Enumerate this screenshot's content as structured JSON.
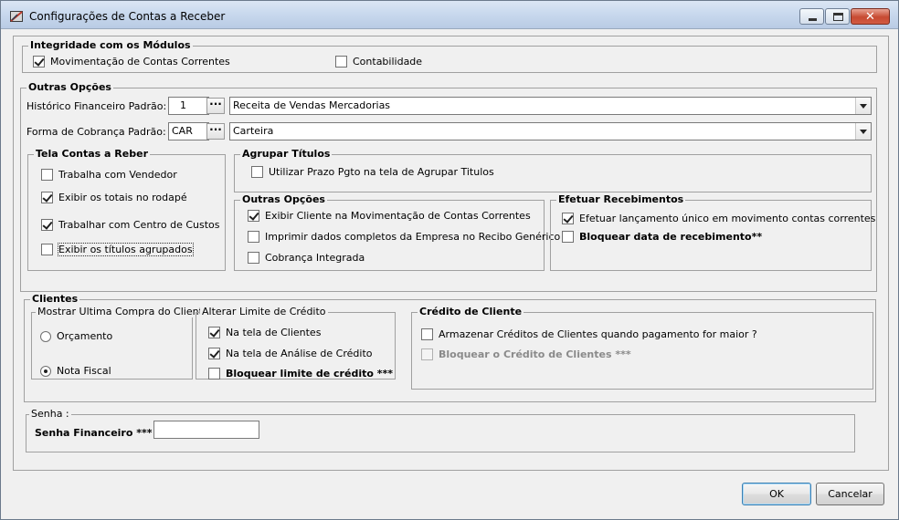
{
  "window": {
    "title": "Configurações de Contas a Receber",
    "icon": "config-app-icon",
    "controls": {
      "minimize": "minimize-icon",
      "maximize": "maximize-icon",
      "close": "✕"
    }
  },
  "integridade": {
    "legend": "Integridade com os Módulos",
    "movimentacao": {
      "label": "Movimentação de Contas Correntes",
      "checked": true
    },
    "contabilidade": {
      "label": "Contabilidade",
      "checked": false
    }
  },
  "outras_opcoes_top": {
    "legend": "Outras Opções",
    "historico_label": "Histórico Financeiro Padrão:",
    "historico_code": "1",
    "historico_desc": "Receita de Vendas Mercadorias",
    "forma_label": "Forma de Cobrança Padrão:",
    "forma_code": "CAR",
    "forma_desc": "Carteira",
    "ellipsis": "···"
  },
  "tela_contas": {
    "legend": "Tela  Contas a Reber",
    "vendedor": {
      "label": "Trabalha com Vendedor",
      "checked": false
    },
    "totais": {
      "label": "Exibir os totais no rodapé",
      "checked": true
    },
    "centro": {
      "label": "Trabalhar com Centro de Custos",
      "checked": true
    },
    "agrupados": {
      "label": "Exibir os títulos agrupados",
      "checked": false
    }
  },
  "agrupar": {
    "legend": "Agrupar  Títulos",
    "prazo": {
      "label": "Utilizar Prazo Pgto na tela de Agrupar Titulos",
      "checked": false
    }
  },
  "outras_opcoes_inner": {
    "legend": "Outras Opções",
    "exibir_cliente": {
      "label": "Exibir Cliente na Movimentação de Contas Correntes",
      "checked": true
    },
    "imprimir": {
      "label": "Imprimir dados completos da Empresa no Recibo Genérico",
      "checked": false
    },
    "cobranca": {
      "label": "Cobrança Integrada",
      "checked": false
    }
  },
  "efetuar": {
    "legend": "Efetuar Recebimentos",
    "lancamento": {
      "label": "Efetuar lançamento único em movimento contas correntes",
      "checked": true
    },
    "bloquear_data": {
      "label": "Bloquear data de recebimento**",
      "checked": false
    }
  },
  "clientes": {
    "legend": "Clientes",
    "ultima_compra": {
      "legend": "Mostrar Ultima Compra do Cliente",
      "orcamento": {
        "label": "Orçamento",
        "selected": false
      },
      "nota_fiscal": {
        "label": "Nota Fiscal",
        "selected": true
      }
    },
    "limite": {
      "legend": "Alterar Limite de Crédito",
      "tela_clientes": {
        "label": "Na tela de Clientes",
        "checked": true
      },
      "tela_analise": {
        "label": "Na tela de Análise de Crédito",
        "checked": true
      },
      "bloquear_limite": {
        "label": "Bloquear limite de crédito ***",
        "checked": false
      }
    },
    "credito": {
      "legend": "Crédito de Cliente",
      "armazenar": {
        "label": "Armazenar Créditos de Clientes quando pagamento for maior ?",
        "checked": false
      },
      "bloquear_credito": {
        "label": "Bloquear o Crédito de Clientes ***",
        "checked": false,
        "disabled": true
      }
    }
  },
  "senha": {
    "legend": "Senha :",
    "label": "Senha Financeiro *** .",
    "value": ""
  },
  "buttons": {
    "ok": "OK",
    "cancel": "Cancelar"
  }
}
